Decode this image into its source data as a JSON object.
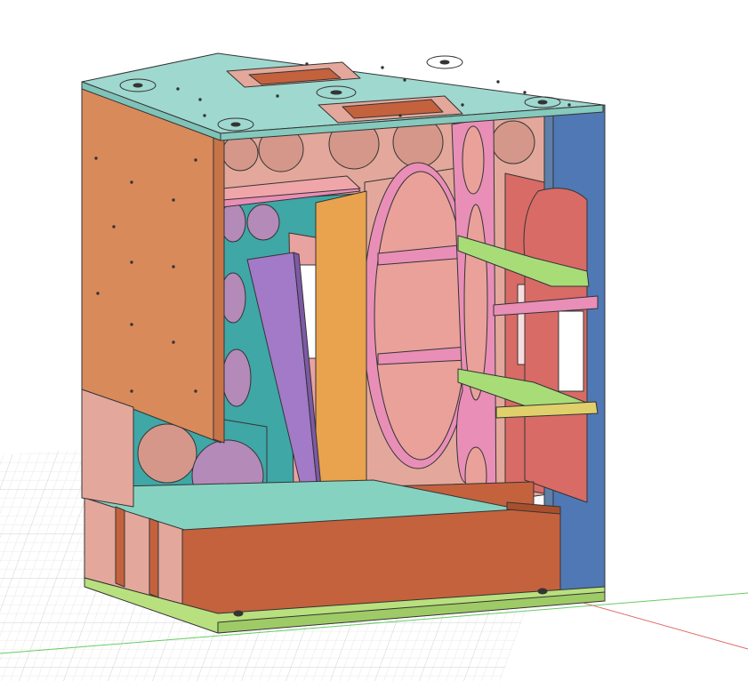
{
  "viewport": {
    "background": "#ffffff"
  },
  "colors": {
    "grid_minor": "#e6e6e6",
    "grid_major": "#cfcfcf",
    "axis_x": "#e06a6a",
    "axis_y": "#66cc66",
    "top_panel": "#9fd8cf",
    "left_panel": "#d88a5b",
    "right_panel": "#4f78b5",
    "rear_wall": "#e3a89b",
    "teal_panel": "#3fa7a6",
    "shelf": "#86d2c1",
    "orange_divider": "#e9a24e",
    "purple_panel": "#a27ac8",
    "pink_panel": "#e98eb7",
    "red_panel": "#d86b66",
    "lime_shelf": "#a8dc77",
    "yellow_shelf": "#e0d06b",
    "base": "#b8e07e",
    "chamber_brown": "#c4623e",
    "edge": "#343434"
  },
  "model": {
    "name": "",
    "parts": [
      "top-panel",
      "left-side-panel",
      "right-side-panel",
      "rear-wall",
      "teal-baffle",
      "purple-board",
      "orange-divider",
      "pink-ring-panel",
      "red-bracket-panel",
      "lime-shelf-upper",
      "lime-shelf-lower",
      "yellow-shelf",
      "middle-shelf",
      "brown-chamber",
      "base-panel"
    ]
  }
}
